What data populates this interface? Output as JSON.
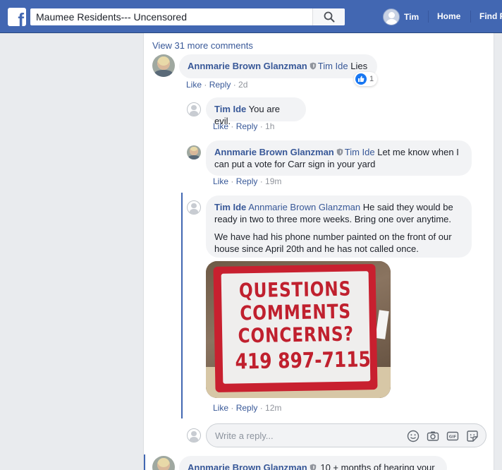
{
  "header": {
    "search_value": "Maumee Residents--- Uncensored",
    "user_name": "Tim",
    "nav_home": "Home",
    "nav_find": "Find F",
    "brand_color": "#4267b2"
  },
  "comments": {
    "view_more": "View 31 more comments",
    "top": {
      "author": "Annmarie Brown Glanzman",
      "mention": "Tim Ide",
      "text": " Lies",
      "like_action": "Like",
      "reply_action": "Reply",
      "time": "2d",
      "reactions_count": "1"
    },
    "replies": [
      {
        "author": "Tim Ide",
        "text": " You are evil.",
        "like_action": "Like",
        "reply_action": "Reply",
        "time": "1h"
      },
      {
        "author": "Annmarie Brown Glanzman",
        "mention": "Tim Ide",
        "text_line1": " Let me know when I",
        "text_line2": "can put a vote for Carr sign in your yard",
        "like_action": "Like",
        "reply_action": "Reply",
        "time": "19m"
      },
      {
        "author": "Tim Ide",
        "mention": "Annmarie Brown Glanzman",
        "text_line1": " He said they would be",
        "text_line2": "ready in two to three more weeks. Bring one over anytime.",
        "para2_line1": "We have had his phone number painted on the front of our",
        "para2_line2": "house since April 20th and he has not called once.",
        "like_action": "Like",
        "reply_action": "Reply",
        "time": "12m"
      }
    ],
    "photo_sign": {
      "line1": "QUESTIONS",
      "line2": "COMMENTS",
      "line3": "CONCERNS?",
      "line4": "419 897-7115"
    },
    "reply_placeholder": "Write a reply...",
    "reply_icons": [
      "emoji-icon",
      "camera-icon",
      "gif-icon",
      "sticker-icon"
    ],
    "next": {
      "author": "Annmarie Brown Glanzman",
      "text": " 10 + months of hearing your"
    }
  }
}
